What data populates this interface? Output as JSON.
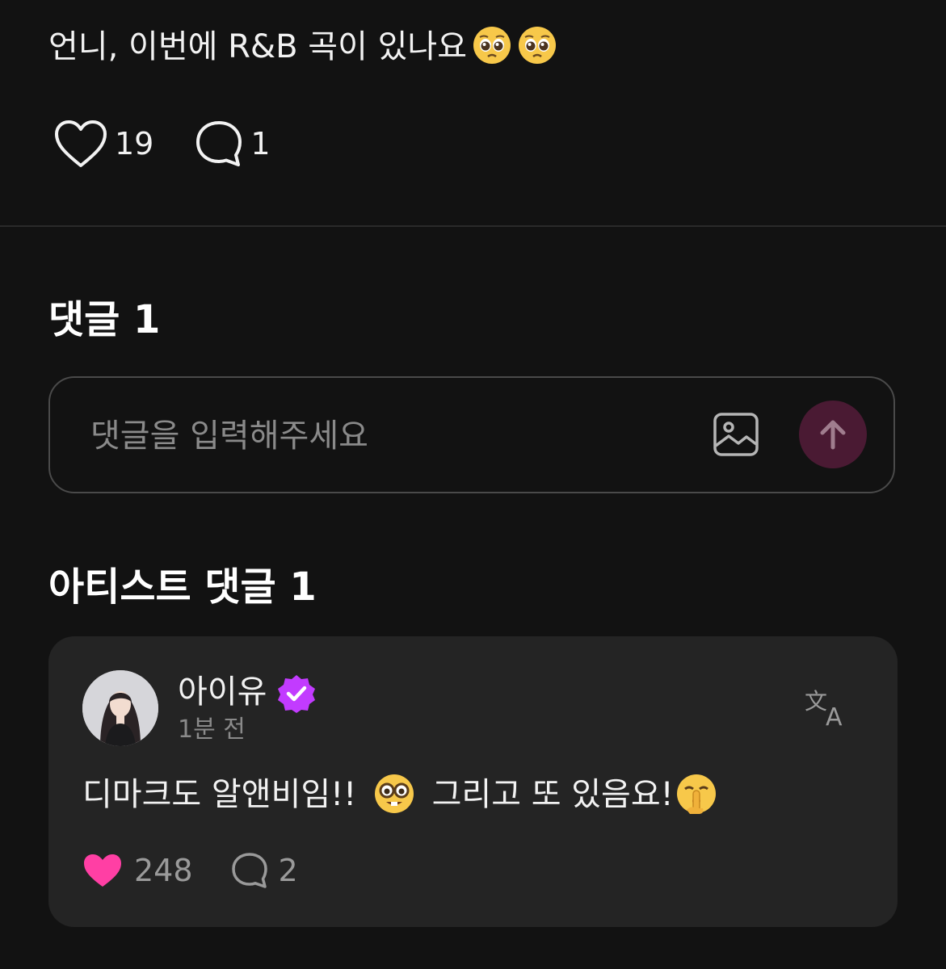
{
  "post": {
    "text": "언니, 이번에 R&B 곡이 있나요",
    "emoji": [
      "pleading-face",
      "pleading-face"
    ],
    "likes": "19",
    "comments": "1"
  },
  "comments_section": {
    "title": "댓글 1",
    "input_placeholder": "댓글을 입력해주세요"
  },
  "artist_section": {
    "title": "아티스트 댓글 1",
    "comment": {
      "author": "아이유",
      "time": "1분 전",
      "text_part1": "디마크도 알앤비임!!",
      "text_part2": "그리고 또 있음요!",
      "likes": "248",
      "replies": "2"
    }
  },
  "colors": {
    "background": "#121212",
    "card": "#242424",
    "heart_active": "#ff3fa4",
    "verified": "#c23bff",
    "send_button": "#4a1a33"
  }
}
